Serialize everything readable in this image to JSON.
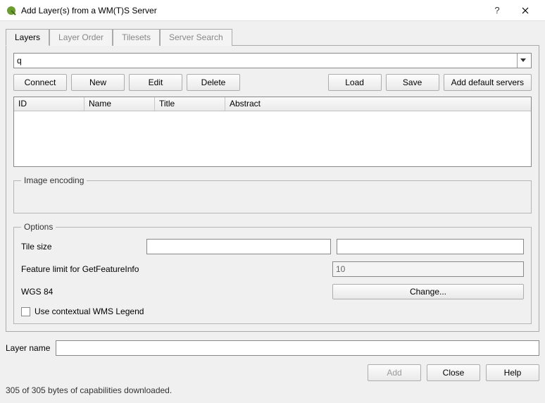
{
  "window": {
    "title": "Add Layer(s) from a WM(T)S Server"
  },
  "tabs": [
    {
      "label": "Layers",
      "active": true
    },
    {
      "label": "Layer Order",
      "active": false
    },
    {
      "label": "Tilesets",
      "active": false
    },
    {
      "label": "Server Search",
      "active": false
    }
  ],
  "server": {
    "selected": "q"
  },
  "buttons": {
    "connect": "Connect",
    "new": "New",
    "edit": "Edit",
    "delete": "Delete",
    "load": "Load",
    "save": "Save",
    "add_default": "Add default servers"
  },
  "table": {
    "headers": {
      "id": "ID",
      "name": "Name",
      "title": "Title",
      "abstract": "Abstract"
    },
    "rows": []
  },
  "image_encoding": {
    "legend": "Image encoding"
  },
  "options": {
    "legend": "Options",
    "tile_size_label": "Tile size",
    "tile_size_a": "",
    "tile_size_b": "",
    "feature_limit_label": "Feature limit for GetFeatureInfo",
    "feature_limit_value": "10",
    "crs_label": "WGS 84",
    "change_label": "Change...",
    "contextual_legend_label": "Use contextual WMS Legend",
    "contextual_legend_checked": false
  },
  "layer_name": {
    "label": "Layer name",
    "value": ""
  },
  "bottom": {
    "add": "Add",
    "close": "Close",
    "help": "Help"
  },
  "status": "305 of 305 bytes of capabilities downloaded."
}
